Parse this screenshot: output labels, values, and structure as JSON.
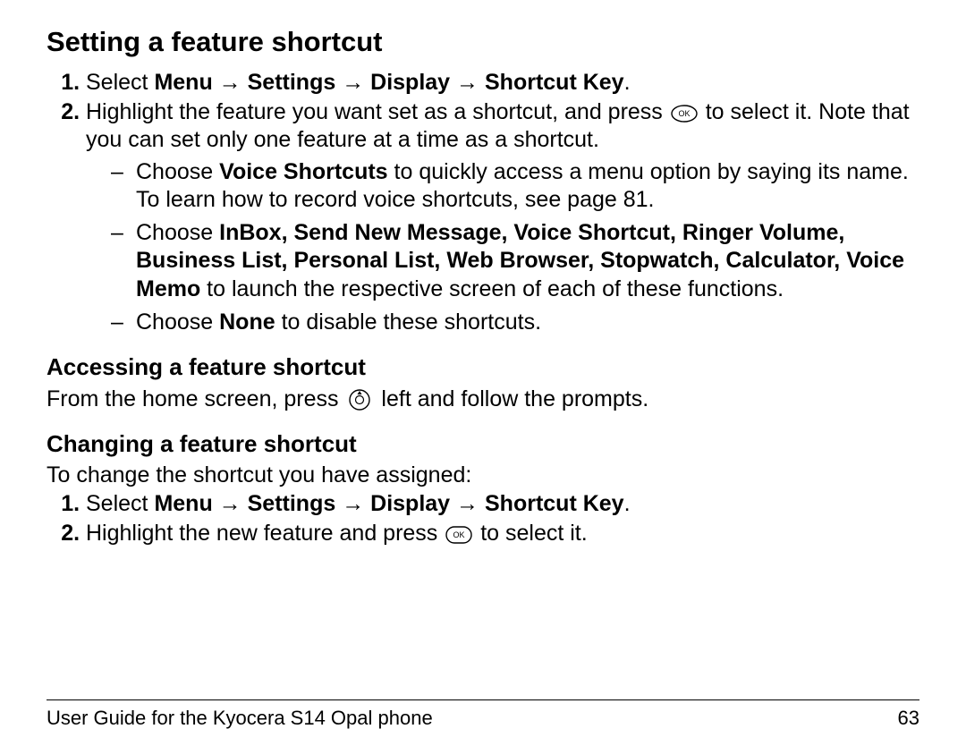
{
  "title": "Setting a feature shortcut",
  "arrow": "→",
  "nav": {
    "menu": "Menu",
    "settings": "Settings",
    "display": "Display",
    "shortcut_key": "Shortcut Key"
  },
  "step1_prefix": "Select ",
  "step2_a": "Highlight the feature you want set as a shortcut, and press ",
  "step2_b": " to select it. Note that you can set only one feature at a time as a shortcut.",
  "sub1_a": "Choose ",
  "sub1_bold": "Voice Shortcuts",
  "sub1_b": " to quickly access a menu option by saying its name. To learn how to record voice shortcuts, see page 81.",
  "sub2_a": "Choose ",
  "sub2_bold": "InBox, Send New Message, Voice Shortcut, Ringer Volume, Business List, Personal List, Web Browser, Stopwatch, Calculator, Voice Memo",
  "sub2_b": " to launch the respective screen of each of these functions.",
  "sub3_a": "Choose ",
  "sub3_bold": "None",
  "sub3_b": " to disable these shortcuts.",
  "access_head": "Accessing a feature shortcut",
  "access_a": "From the home screen, press ",
  "access_b": " left and follow the prompts.",
  "change_head": "Changing a feature shortcut",
  "change_intro": "To change the shortcut you have assigned:",
  "change2_a": "Highlight the new feature and press ",
  "change2_b": " to select it.",
  "footer_left": "User Guide for the Kyocera S14 Opal phone",
  "footer_right": "63",
  "period": "."
}
